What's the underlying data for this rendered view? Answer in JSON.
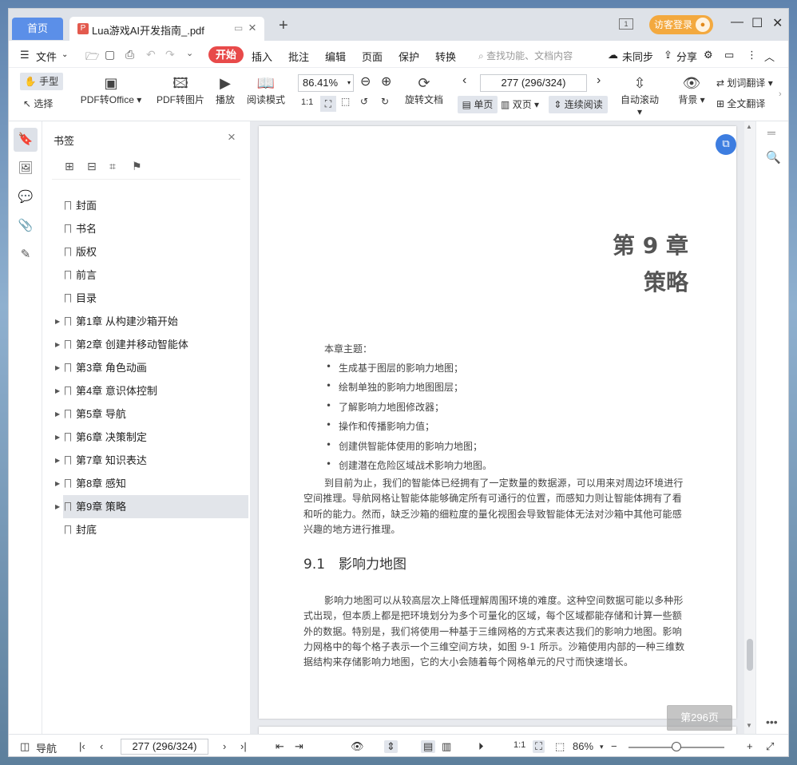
{
  "tabs": {
    "home": "首页",
    "doc_title": "Lua游戏AI开发指南_.pdf",
    "new_tab": "+"
  },
  "title_right": {
    "login": "访客登录"
  },
  "menu": {
    "file": "文件",
    "start": "开始",
    "items": [
      "插入",
      "批注",
      "编辑",
      "页面",
      "保护",
      "转换"
    ],
    "search_placeholder": "查找功能、文档内容",
    "unsync": "未同步",
    "share": "分享"
  },
  "toolbar": {
    "hand": "手型",
    "select": "选择",
    "pdf_to_office": "PDF转Office",
    "pdf_to_image": "PDF转图片",
    "play": "播放",
    "reading_mode": "阅读模式",
    "zoom": "86.41%",
    "rotate_doc": "旋转文档",
    "page_indicator": "277 (296/324)",
    "single_page": "单页",
    "double_page": "双页",
    "continuous": "连续阅读",
    "auto_scroll": "自动滚动",
    "background": "背景",
    "word_translate": "划词翻译",
    "full_translate": "全文翻译"
  },
  "bookmarks": {
    "title": "书签",
    "items": [
      {
        "label": "封面",
        "expandable": false
      },
      {
        "label": "书名",
        "expandable": false
      },
      {
        "label": "版权",
        "expandable": false
      },
      {
        "label": "前言",
        "expandable": false
      },
      {
        "label": "目录",
        "expandable": false
      },
      {
        "label": "第1章 从构建沙箱开始",
        "expandable": true
      },
      {
        "label": "第2章 创建并移动智能体",
        "expandable": true
      },
      {
        "label": "第3章 角色动画",
        "expandable": true
      },
      {
        "label": "第4章 意识体控制",
        "expandable": true
      },
      {
        "label": "第5章 导航",
        "expandable": true
      },
      {
        "label": "第6章 决策制定",
        "expandable": true
      },
      {
        "label": "第7章 知识表达",
        "expandable": true
      },
      {
        "label": "第8章 感知",
        "expandable": true
      },
      {
        "label": "第9章 策略",
        "expandable": true,
        "selected": true
      },
      {
        "label": "封底",
        "expandable": false
      }
    ]
  },
  "document": {
    "chapter_number": "第 9 章",
    "chapter_name": "策略",
    "topics_heading": "本章主题：",
    "topics": [
      "生成基于图层的影响力地图；",
      "绘制单独的影响力地图图层；",
      "了解影响力地图修改器；",
      "操作和传播影响力值；",
      "创建供智能体使用的影响力地图；",
      "创建潜在危险区域战术影响力地图。"
    ],
    "intro_paragraph": "到目前为止，我们的智能体已经拥有了一定数量的数据源，可以用来对周边环境进行空间推理。导航网格让智能体能够确定所有可通行的位置，而感知力则让智能体拥有了看和听的能力。然而，缺乏沙箱的细粒度的量化视图会导致智能体无法对沙箱中其他可能感兴趣的地方进行推理。",
    "section_heading": "9.1　影响力地图",
    "section_paragraph": "影响力地图可以从较高层次上降低理解周围环境的难度。这种空间数据可能以多种形式出现，但本质上都是把环境划分为多个可量化的区域，每个区域都能存储和计算一些额外的数据。特别是，我们将使用一种基于三维网格的方式来表达我们的影响力地图。影响力网格中的每个格子表示一个三维空间方块，如图 9-1 所示。沙箱使用内部的一种三维数据结构来存储影响力地图，它的大小会随着每个网格单元的尺寸而快速增长。",
    "page_badge": "第296页"
  },
  "status": {
    "nav": "导航",
    "page_indicator": "277 (296/324)",
    "zoom": "86%"
  }
}
